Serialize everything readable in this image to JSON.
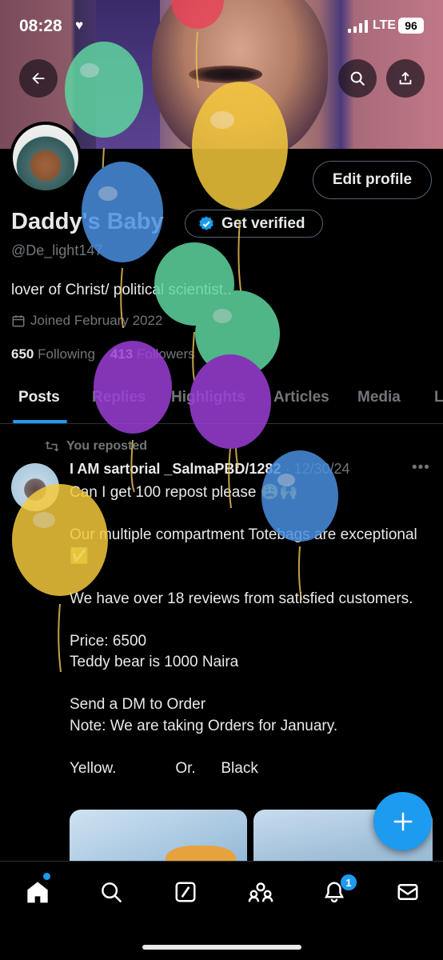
{
  "status_bar": {
    "time": "08:28",
    "network": "LTE",
    "battery": "96"
  },
  "header": {
    "back_icon": "arrow-left-icon",
    "search_icon": "search-icon",
    "share_icon": "share-icon"
  },
  "profile": {
    "edit_button": "Edit profile",
    "display_name": "Daddy's Baby",
    "verify_label": "Get verified",
    "handle": "@De_light147",
    "bio": "lover of Christ/ political scientist..",
    "joined": "Joined February 2022",
    "following_count": "650",
    "following_label": "Following",
    "followers_count": "413",
    "followers_label": "Followers"
  },
  "tabs": [
    {
      "label": "Posts",
      "active": true
    },
    {
      "label": "Replies"
    },
    {
      "label": "Highlights"
    },
    {
      "label": "Articles"
    },
    {
      "label": "Media"
    },
    {
      "label": "L"
    }
  ],
  "post": {
    "repost_label": "You reposted",
    "author": "I AM sartorial _SalmaPBD/1282",
    "date": "· 12/30/24",
    "more": "•••",
    "lines": [
      "Can I get 100 repost please 😩🙌",
      "",
      "Our multiple compartment Totebags are exceptional ✅",
      "",
      "We have over 18 reviews from satisfied customers.",
      "",
      "Price: 6500",
      "Teddy bear is 1000 Naira",
      "",
      "Send a DM to Order",
      "Note: We are taking Orders for January.",
      "",
      "Yellow.              Or.      Black"
    ]
  },
  "bottom_nav": {
    "items": [
      "home-icon",
      "search-icon",
      "grok-icon",
      "communities-icon",
      "notifications-icon",
      "messages-icon"
    ],
    "notification_count": "1"
  },
  "colors": {
    "accent": "#1d9bf0",
    "background": "#000000",
    "text": "#e7e9ea",
    "muted": "#71767b"
  }
}
